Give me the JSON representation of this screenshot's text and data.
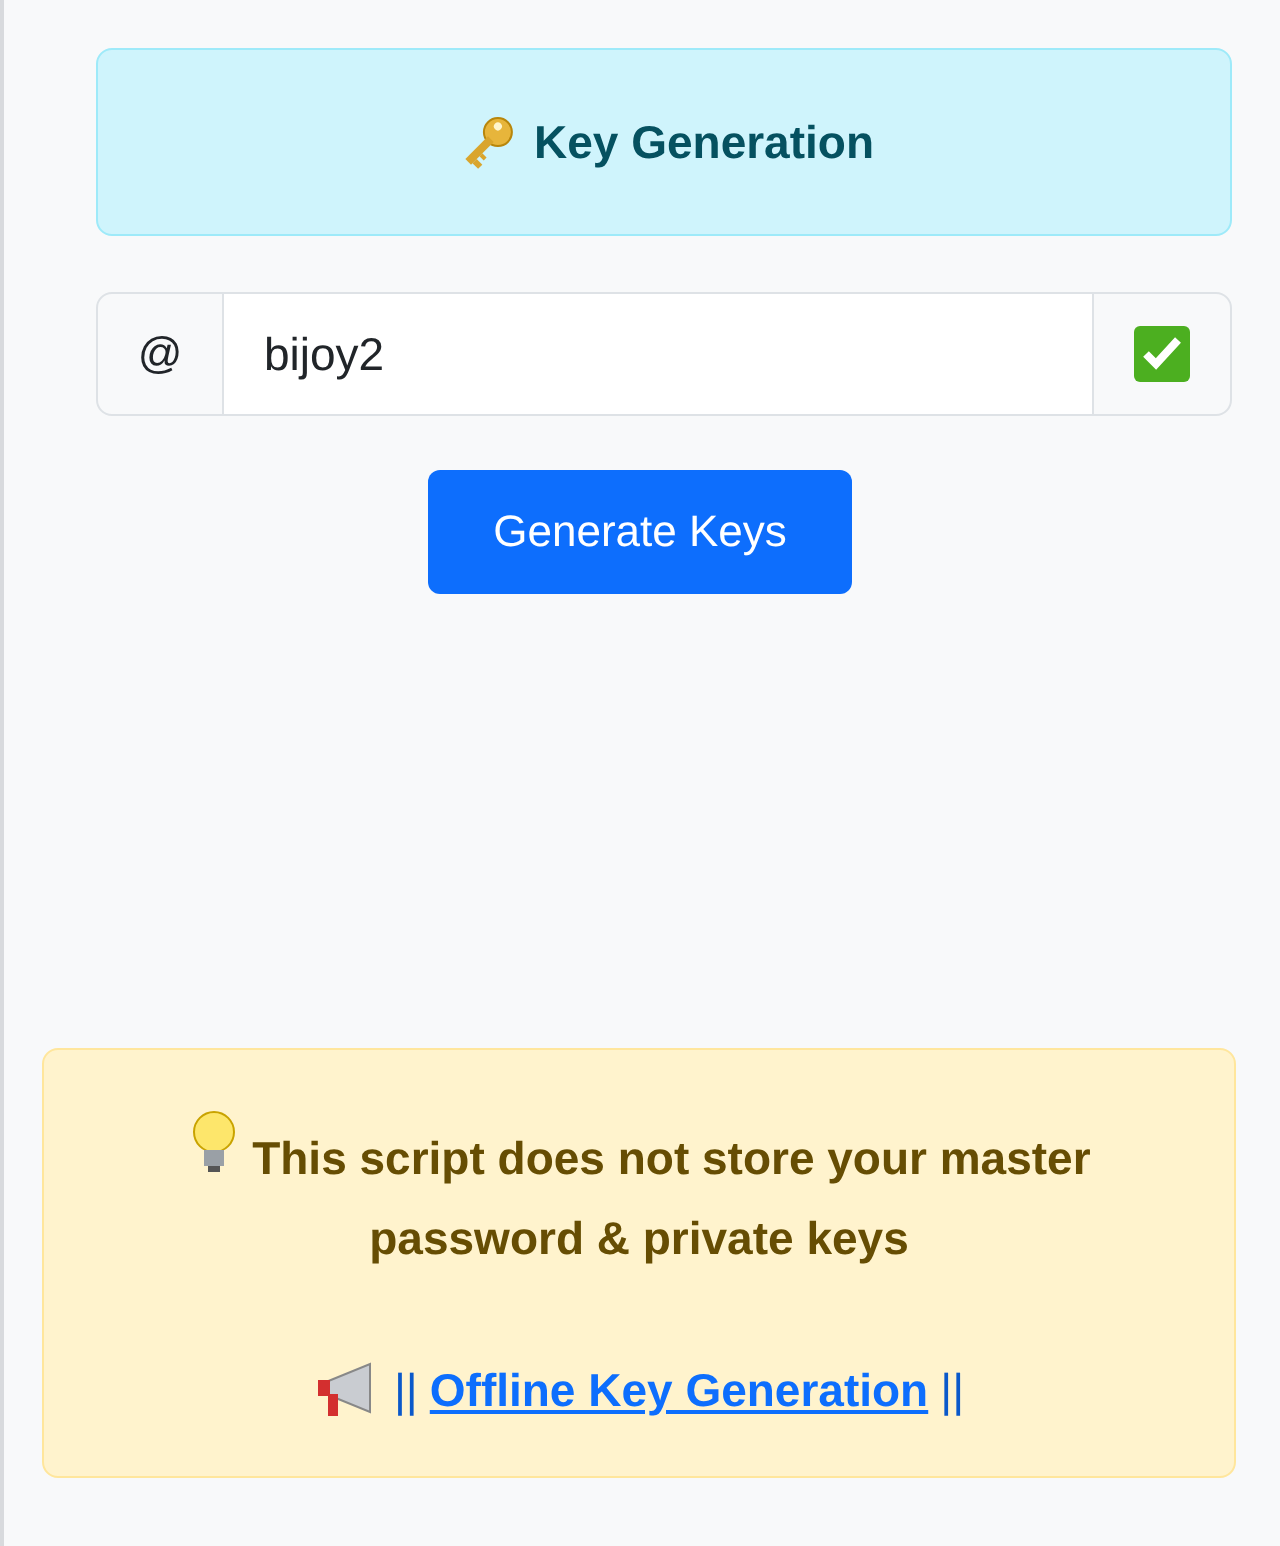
{
  "header": {
    "title": "Key Generation"
  },
  "username_field": {
    "prefix": "@",
    "value": "bijoy2",
    "valid": true
  },
  "generate_button": {
    "label": "Generate Keys"
  },
  "notice": {
    "text": "This script does not store your master password & private keys",
    "link_prefix": "||",
    "link": "Offline Key Generation",
    "link_suffix": "||"
  }
}
